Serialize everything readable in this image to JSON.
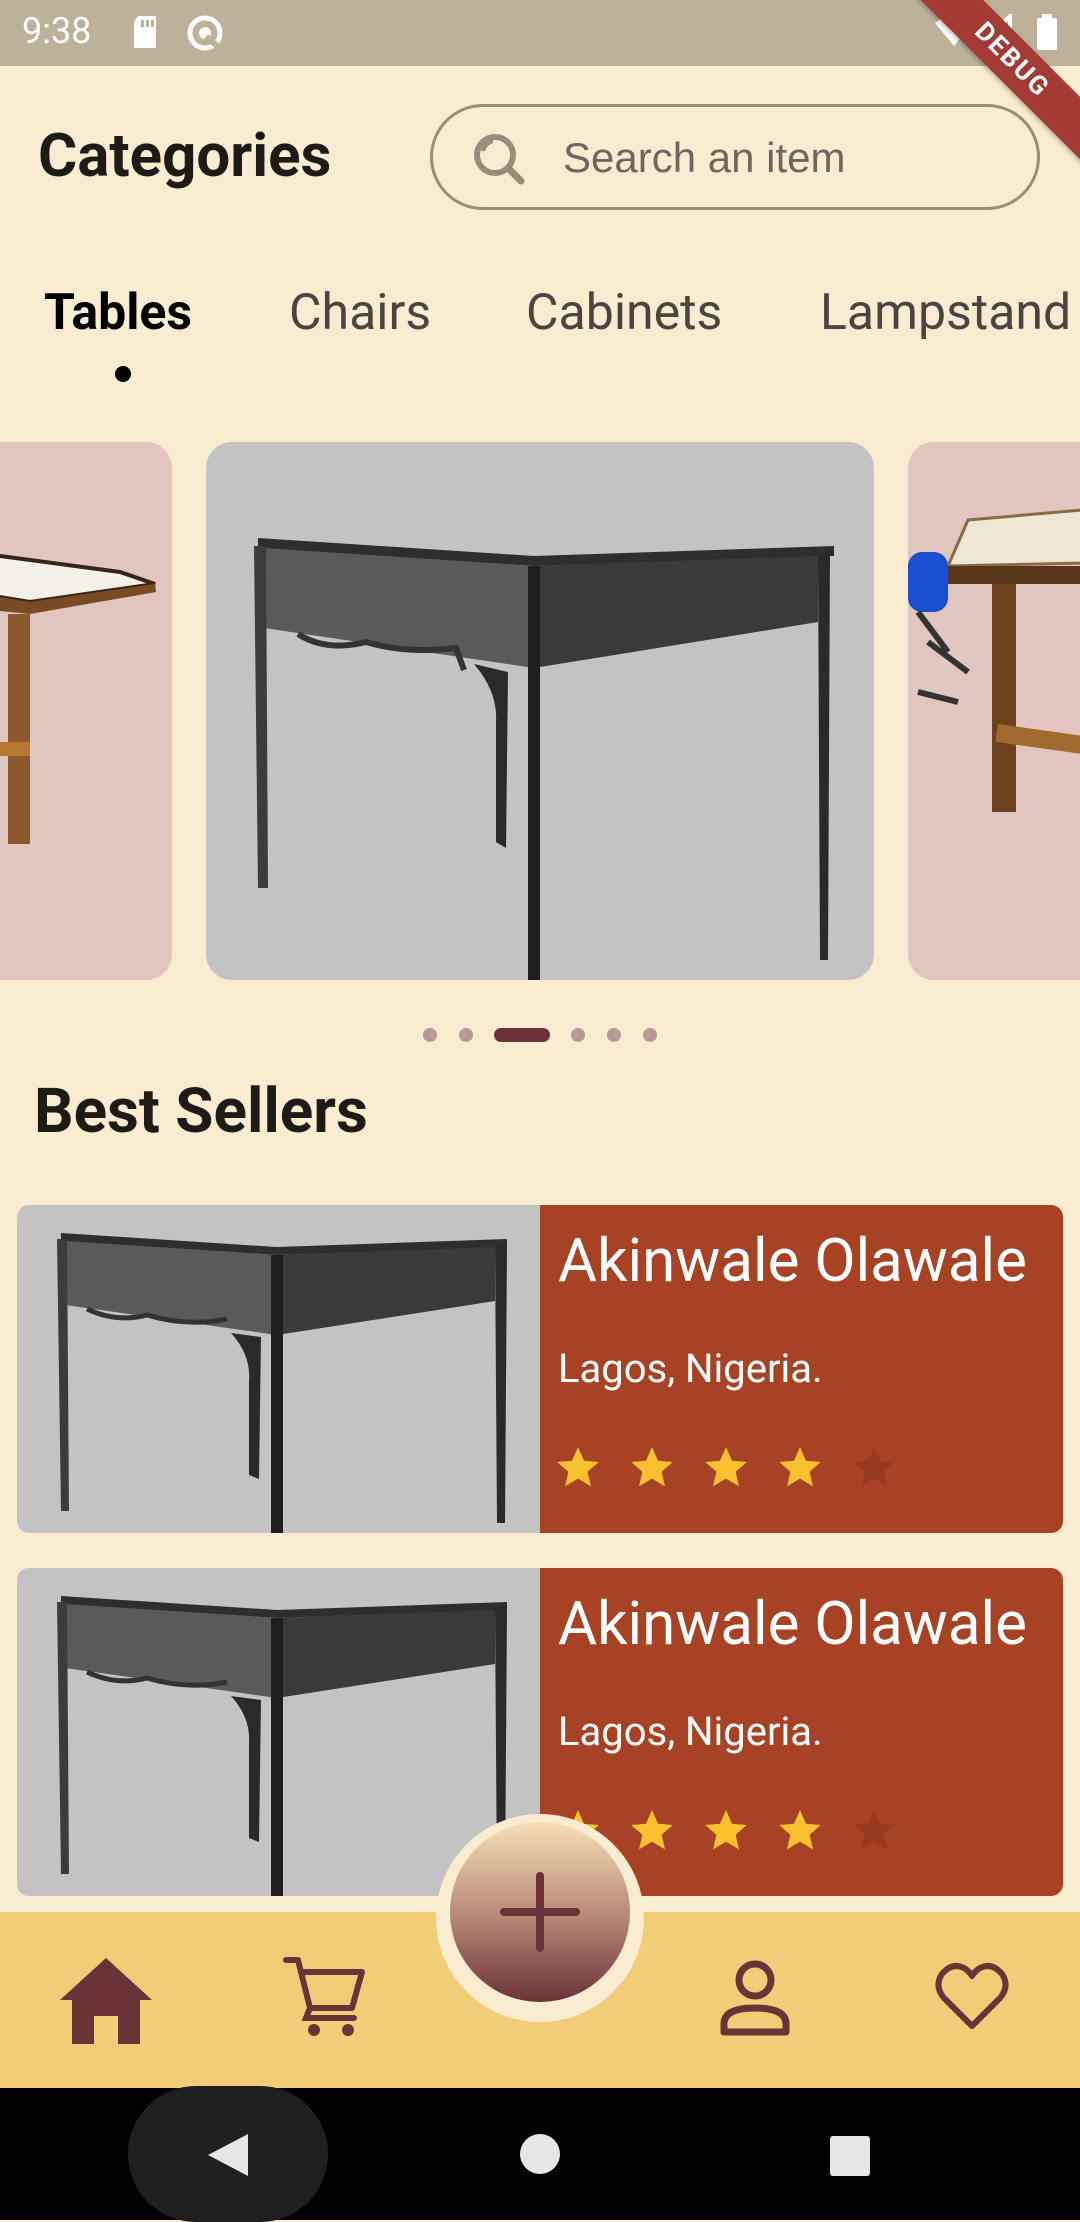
{
  "status_bar": {
    "time": "9:38",
    "debug_label": "DEBUG"
  },
  "header": {
    "title": "Categories",
    "search_placeholder": "Search an item"
  },
  "tabs": [
    {
      "label": "Tables",
      "active": true
    },
    {
      "label": "Chairs",
      "active": false
    },
    {
      "label": "Cabinets",
      "active": false
    },
    {
      "label": "Lampstand",
      "active": false
    }
  ],
  "carousel": {
    "page_count": 6,
    "active_page": 3
  },
  "best_sellers": {
    "title": "Best Sellers",
    "items": [
      {
        "name": "Akinwale Olawale",
        "location": "Lagos, Nigeria.",
        "rating": 4,
        "max_rating": 5
      },
      {
        "name": "Akinwale Olawale",
        "location": "Lagos, Nigeria.",
        "rating": 4,
        "max_rating": 5
      }
    ]
  },
  "bottom_nav": {
    "items": [
      "home-icon",
      "cart-icon",
      "add-icon",
      "profile-icon",
      "heart-icon"
    ],
    "active": "home-icon"
  },
  "colors": {
    "background": "#FAECD1",
    "accent": "#6B3338",
    "card_panel": "#A84225",
    "star": "#F9C22E",
    "nav_bar": "#F2CD78"
  }
}
